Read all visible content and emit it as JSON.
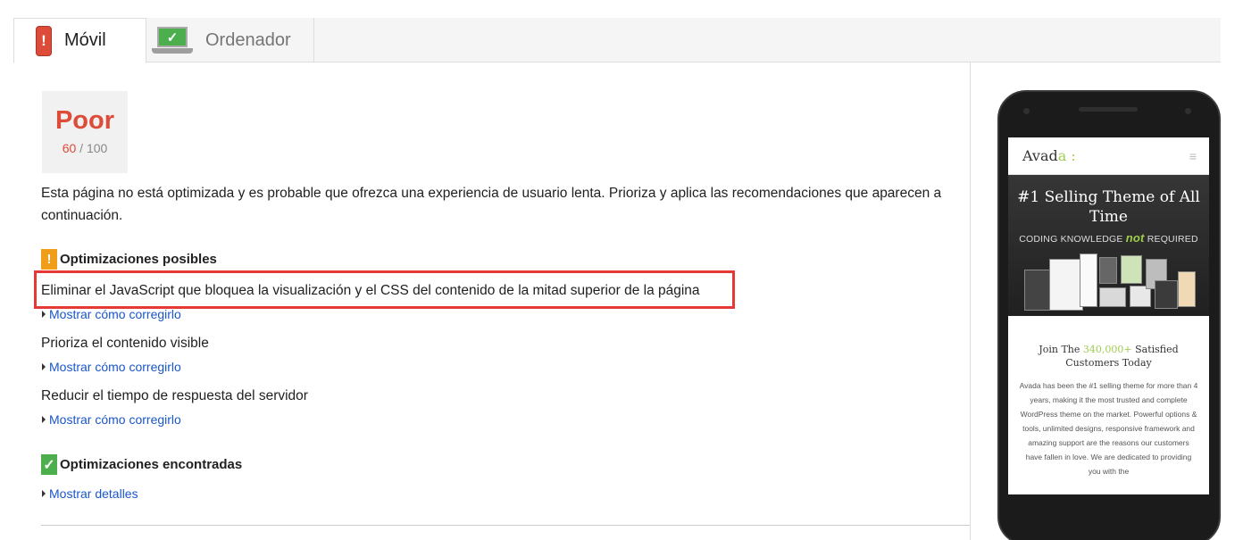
{
  "tabs": [
    {
      "label": "Móvil",
      "icon": "mobile-warning-icon",
      "active": true
    },
    {
      "label": "Ordenador",
      "icon": "desktop-ok-icon",
      "active": false
    }
  ],
  "score": {
    "rating": "Poor",
    "value": "60",
    "separator": " / ",
    "max": "100",
    "color": "#dd4b39"
  },
  "summary": "Esta página no está optimizada y es probable que ofrezca una experiencia de usuario lenta. Prioriza y aplica las recomendaciones que aparecen a continuación.",
  "possible": {
    "badge": "!",
    "title": "Optimizaciones posibles",
    "rules": [
      {
        "title": "Eliminar el JavaScript que bloquea la visualización y el CSS del contenido de la mitad superior de la página",
        "link": "Mostrar cómo corregirlo",
        "highlighted": true
      },
      {
        "title": "Prioriza el contenido visible",
        "link": "Mostrar cómo corregirlo"
      },
      {
        "title": "Reducir el tiempo de respuesta del servidor",
        "link": "Mostrar cómo corregirlo"
      }
    ]
  },
  "found": {
    "badge": "✓",
    "title": "Optimizaciones encontradas",
    "link": "Mostrar detalles"
  },
  "preview": {
    "logo_main": "Avad",
    "logo_accent": "a :",
    "menu_icon": "≡",
    "hero_title": "#1 Selling Theme of All Time",
    "hero_sub_before": "CODING KNOWLEDGE",
    "hero_sub_not": "not",
    "hero_sub_after": "REQUIRED",
    "join_before": "Join The",
    "join_highlight": "340,000+",
    "join_after": "Satisfied Customers Today",
    "paragraph": "Avada has been the #1 selling theme for more than 4 years, making it the most trusted and complete WordPress theme on the market.  Powerful options & tools, unlimited designs, responsive framework and amazing support are the reasons our customers have fallen in love.  We are dedicated to providing you with the",
    "accent_color": "#a0ce4e"
  }
}
